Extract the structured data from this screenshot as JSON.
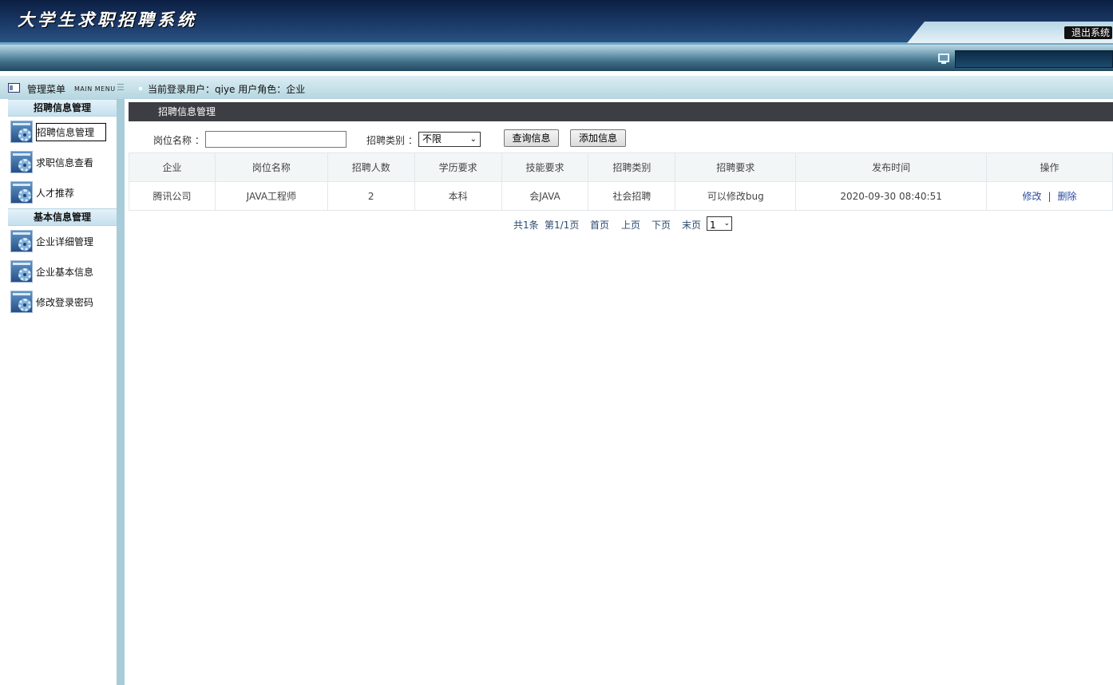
{
  "header": {
    "app_title": "大学生求职招聘系统",
    "logout_label": "退出系统"
  },
  "infobar": {
    "menu_title": "管理菜单",
    "menu_sub": "MAIN MENU",
    "menu_lines": "☰",
    "user_info": "当前登录用户：qiye  用户角色：企业"
  },
  "sidebar": {
    "groups": [
      {
        "title": "招聘信息管理",
        "items": [
          {
            "label": "招聘信息管理",
            "icon": "gear-icon",
            "active": true
          },
          {
            "label": "求职信息查看",
            "icon": "gear-icon"
          },
          {
            "label": "人才推荐",
            "icon": "gear-icon"
          }
        ]
      },
      {
        "title": "基本信息管理",
        "items": [
          {
            "label": "企业详细管理",
            "icon": "gear-icon"
          },
          {
            "label": "企业基本信息",
            "icon": "gear-icon"
          },
          {
            "label": "修改登录密码",
            "icon": "gear-icon"
          }
        ]
      }
    ]
  },
  "main": {
    "panel_title": "招聘信息管理",
    "search": {
      "job_label": "岗位名称 ：",
      "job_value": "",
      "category_label": "招聘类别 ：",
      "category_selected": "不限",
      "query_button": "查询信息",
      "add_button": "添加信息"
    },
    "table": {
      "headers": [
        "企业",
        "岗位名称",
        "招聘人数",
        "学历要求",
        "技能要求",
        "招聘类别",
        "招聘要求",
        "发布时间",
        "操作"
      ],
      "rows": [
        {
          "company": "腾讯公司",
          "position": "JAVA工程师",
          "count": "2",
          "education": "本科",
          "skill": "会JAVA",
          "category": "社会招聘",
          "requirement": "可以修改bug",
          "time": "2020-09-30 08:40:51",
          "edit": "修改",
          "sep": "|",
          "delete": "删除"
        }
      ]
    },
    "pager": {
      "total": "共1条",
      "page_info": "第1/1页",
      "first": "首页",
      "prev": "上页",
      "next": "下页",
      "last": "末页",
      "page_selected": "1"
    }
  }
}
